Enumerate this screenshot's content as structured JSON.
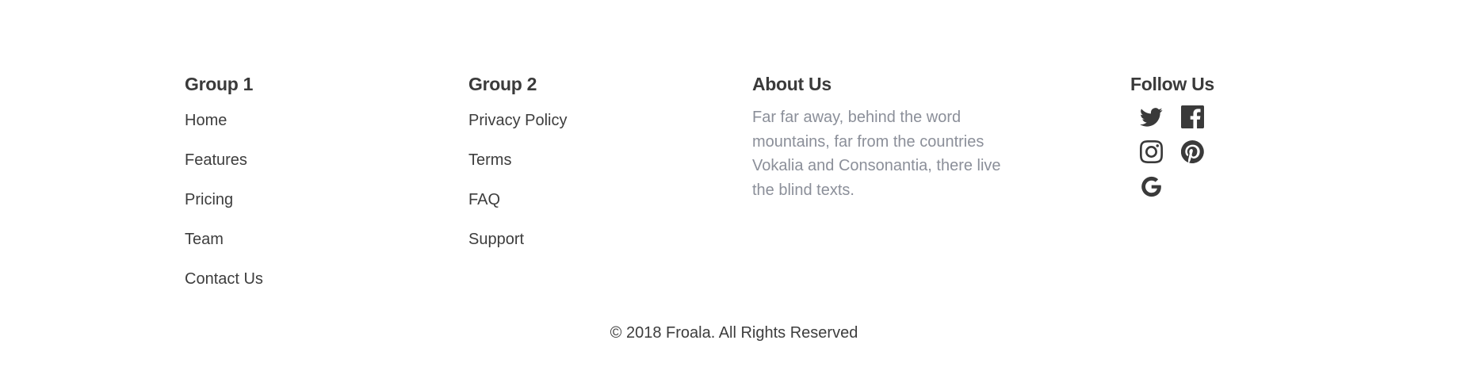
{
  "footer": {
    "group1": {
      "title": "Group 1",
      "links": [
        "Home",
        "Features",
        "Pricing",
        "Team",
        "Contact Us"
      ]
    },
    "group2": {
      "title": "Group 2",
      "links": [
        "Privacy Policy",
        "Terms",
        "FAQ",
        "Support"
      ]
    },
    "about": {
      "title": "About Us",
      "text": "Far far away, behind the word mountains, far from the countries Vokalia and Consonantia, there live the blind texts."
    },
    "follow": {
      "title": "Follow Us",
      "icons": [
        "twitter-icon",
        "facebook-icon",
        "instagram-icon",
        "pinterest-icon",
        "google-icon"
      ]
    },
    "copyright": "© 2018 Froala. All Rights Reserved"
  },
  "colors": {
    "heading": "#3a3a3a",
    "link": "#3d3d3d",
    "muted_text": "#8b8f99",
    "background": "#ffffff"
  }
}
